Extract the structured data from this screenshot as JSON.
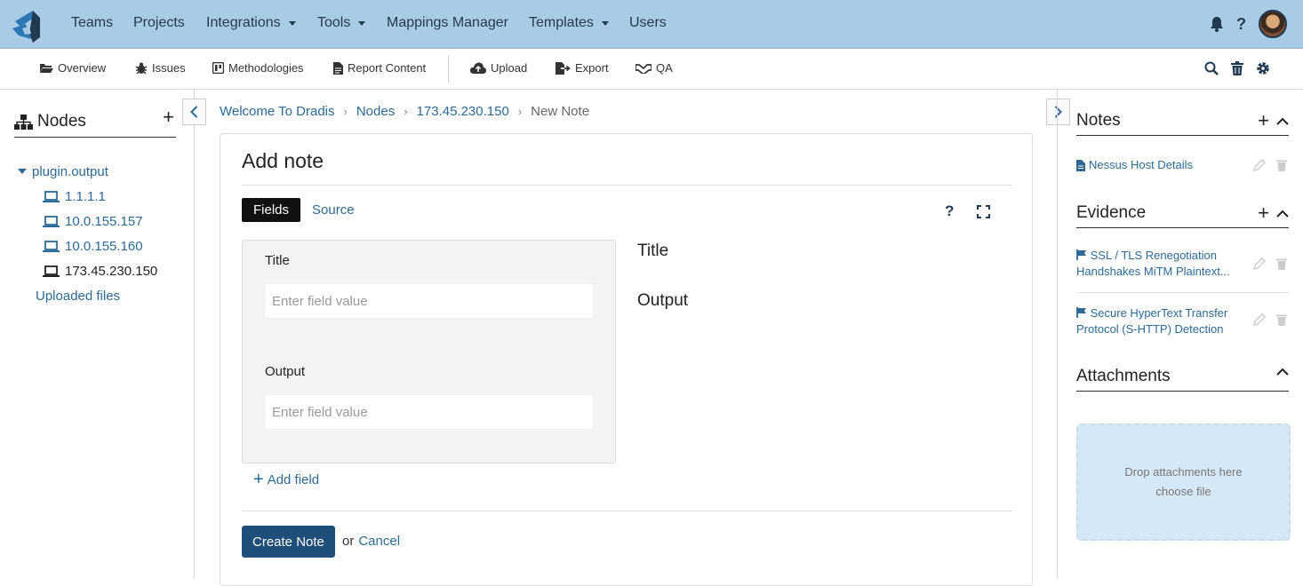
{
  "topnav": {
    "items": [
      {
        "label": "Teams",
        "dropdown": false
      },
      {
        "label": "Projects",
        "dropdown": false
      },
      {
        "label": "Integrations",
        "dropdown": true
      },
      {
        "label": "Tools",
        "dropdown": true
      },
      {
        "label": "Mappings Manager",
        "dropdown": false
      },
      {
        "label": "Templates",
        "dropdown": true
      },
      {
        "label": "Users",
        "dropdown": false
      }
    ],
    "bg_color": "#a8cbe6"
  },
  "subnav": {
    "overview": "Overview",
    "issues": "Issues",
    "methodologies": "Methodologies",
    "report_content": "Report Content",
    "upload": "Upload",
    "export": "Export",
    "qa": "QA"
  },
  "left": {
    "title": "Nodes",
    "root": "plugin.output",
    "children": [
      "1.1.1.1",
      "10.0.155.157",
      "10.0.155.160",
      "173.45.230.150"
    ],
    "uploaded": "Uploaded files"
  },
  "breadcrumb": {
    "home": "Welcome To Dradis",
    "nodes": "Nodes",
    "node": "173.45.230.150",
    "current": "New Note"
  },
  "form": {
    "heading": "Add note",
    "tab_fields": "Fields",
    "tab_source": "Source",
    "help": "?",
    "title_label": "Title",
    "title_placeholder": "Enter field value",
    "output_label": "Output",
    "output_placeholder": "Enter field value",
    "preview_title": "Title",
    "preview_output": "Output",
    "add_field": "Add field",
    "create": "Create Note",
    "or": "or",
    "cancel": "Cancel"
  },
  "right": {
    "notes_title": "Notes",
    "notes": [
      "Nessus Host Details"
    ],
    "evidence_title": "Evidence",
    "evidence": [
      "SSL / TLS Renegotiation Handshakes MiTM Plaintext...",
      "Secure HyperText Transfer Protocol (S-HTTP) Detection"
    ],
    "attachments_title": "Attachments",
    "drop_text": "Drop attachments here",
    "choose_file": "choose file"
  },
  "colors": {
    "link": "#2c6a95",
    "primary_button": "#1f4e79"
  }
}
